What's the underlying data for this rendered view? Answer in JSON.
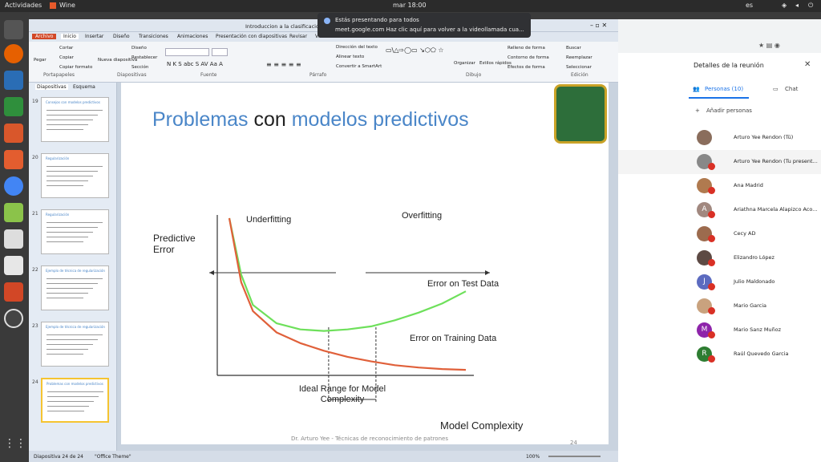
{
  "topbar": {
    "activities": "Actividades",
    "app": "Wine",
    "clock": "mar 18:00",
    "lang": "es"
  },
  "window": {
    "title": "Introduccion a la clasificacionppt"
  },
  "toast": {
    "line1": "Estás presentando para todos",
    "line2": "meet.google.com  Haz clic aquí para volver a la videollamada cua..."
  },
  "ribbon": {
    "tabs": [
      "Archivo",
      "Inicio",
      "Insertar",
      "Diseño",
      "Transiciones",
      "Animaciones",
      "Presentación con diapositivas",
      "Revisar",
      "Vista"
    ],
    "clipboard": {
      "paste": "Pegar",
      "cut": "Cortar",
      "copy": "Copiar",
      "format": "Copiar formato",
      "group": "Portapapeles"
    },
    "slides": {
      "new": "Nueva diapositiva",
      "layout": "Diseño",
      "reset": "Restablecer",
      "section": "Sección",
      "group": "Diapositivas"
    },
    "font_group": "Fuente",
    "paragraph": {
      "dir": "Dirección del texto",
      "align": "Alinear texto",
      "smartart": "Convertir a SmartArt",
      "group": "Párrafo"
    },
    "drawing": {
      "arrange": "Organizar",
      "styles": "Estilos rápidos",
      "fill": "Relleno de forma",
      "outline": "Contorno de forma",
      "effects": "Efectos de forma",
      "group": "Dibujo"
    },
    "editing": {
      "find": "Buscar",
      "replace": "Reemplazar",
      "select": "Seleccionar",
      "group": "Edición"
    }
  },
  "panel": {
    "tab_slides": "Diapositivas",
    "tab_outline": "Esquema"
  },
  "thumbs": [
    {
      "num": "19",
      "title": "Consejos con modelos predictivos"
    },
    {
      "num": "20",
      "title": "Regularización"
    },
    {
      "num": "21",
      "title": "Regularización"
    },
    {
      "num": "22",
      "title": "Ejemplo de técnica de regularización"
    },
    {
      "num": "23",
      "title": "Ejemplo de técnica de regularización"
    },
    {
      "num": "24",
      "title": "Problemas con modelos predictivos"
    }
  ],
  "slide": {
    "title_w1": "Problemas",
    "title_w2": "con",
    "title_w3": "modelos predictivos",
    "footer": "Dr. Arturo Yee - Técnicas de reconocimiento de patrones",
    "page_num": "24"
  },
  "chart_data": {
    "type": "line",
    "ylabel": "Predictive Error",
    "xlabel": "Model Complexity",
    "annotations": [
      "Underfitting",
      "Overfitting",
      "Ideal Range for Model Complexity"
    ],
    "series": [
      {
        "name": "Error on Test Data",
        "color": "#6ee05b",
        "x": [
          0,
          0.5,
          1,
          2,
          3,
          4,
          5,
          6,
          7,
          8,
          9,
          10
        ],
        "values": [
          10,
          6.3,
          4.3,
          3.1,
          2.7,
          2.6,
          2.7,
          2.9,
          3.3,
          3.8,
          4.4,
          5.2
        ]
      },
      {
        "name": "Error on Training Data",
        "color": "#e0603a",
        "x": [
          0,
          0.5,
          1,
          2,
          3,
          4,
          5,
          6,
          7,
          8,
          9,
          10
        ],
        "values": [
          10,
          5.8,
          3.9,
          2.5,
          1.8,
          1.3,
          0.9,
          0.6,
          0.35,
          0.2,
          0.1,
          0.05
        ]
      }
    ],
    "ideal_range": [
      4.2,
      6.2
    ]
  },
  "status": {
    "slide": "Diapositiva 24 de 24",
    "theme": "\"Office Theme\"",
    "zoom": "100%"
  },
  "meet": {
    "title": "Detalles de la reunión",
    "tab_people": "Personas (10)",
    "tab_chat": "Chat",
    "add": "Añadir personas",
    "people": [
      {
        "name": "Arturo Yee Rendon (Tú)",
        "color": "#8a6d5c",
        "letter": ""
      },
      {
        "name": "Arturo Yee Rendon (Tu present...",
        "color": "#888888",
        "letter": ""
      },
      {
        "name": "Ana Madrid",
        "color": "#b07a4f",
        "letter": ""
      },
      {
        "name": "Ariathna Marcela Alapizco Aco...",
        "color": "#a1887f",
        "letter": "A"
      },
      {
        "name": "Cecy AD",
        "color": "#9c6b4e",
        "letter": ""
      },
      {
        "name": "Elizandro López",
        "color": "#5d4a44",
        "letter": ""
      },
      {
        "name": "Julio Maldonado",
        "color": "#5c6bc0",
        "letter": "J"
      },
      {
        "name": "Mario Garcia",
        "color": "#c9a27e",
        "letter": ""
      },
      {
        "name": "Mario Sanz Muñoz",
        "color": "#8e24aa",
        "letter": "M"
      },
      {
        "name": "Raúl Quevedo Garcia",
        "color": "#2e7d32",
        "letter": "R"
      }
    ]
  }
}
